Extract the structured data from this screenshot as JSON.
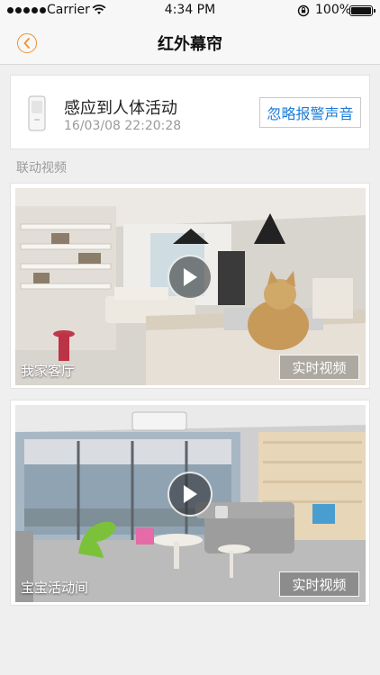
{
  "status_bar": {
    "carrier": "Carrier",
    "time": "4:34 PM",
    "battery": "100%",
    "battery_level": 1.0
  },
  "nav": {
    "title": "红外幕帘",
    "back_icon": "chevron-left-icon",
    "accent_color": "#f0902d"
  },
  "alert": {
    "title": "感应到人体活动",
    "timestamp": "16/03/08 22:20:28",
    "ignore_button": "忽略报警声音",
    "icon": "infrared-sensor-icon",
    "button_text_color": "#1d7cd8"
  },
  "section": {
    "label": "联动视频"
  },
  "videos": [
    {
      "room": "我家客厅",
      "live_button": "实时视频",
      "icon": "play-icon"
    },
    {
      "room": "宝宝活动间",
      "live_button": "实时视频",
      "icon": "play-icon"
    }
  ]
}
